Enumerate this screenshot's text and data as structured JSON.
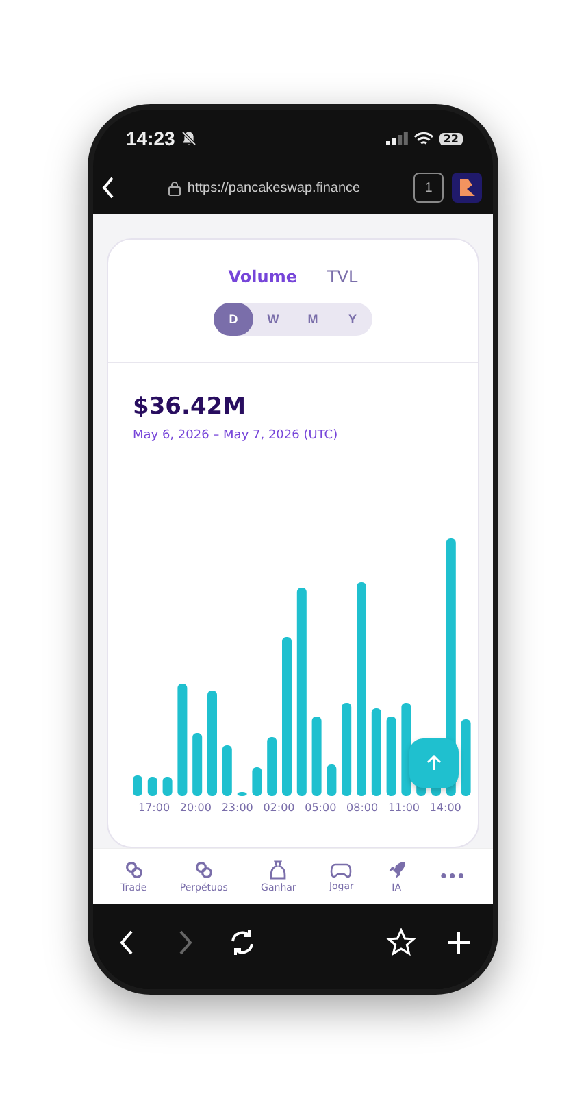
{
  "status_bar": {
    "time": "14:23",
    "battery": "22"
  },
  "browser": {
    "url": "https://pancakeswap.finance",
    "tab_count": "1"
  },
  "metric_tabs": [
    {
      "label": "Volume",
      "selected": true
    },
    {
      "label": "TVL",
      "selected": false
    }
  ],
  "periods": [
    {
      "label": "D",
      "selected": true
    },
    {
      "label": "W",
      "selected": false
    },
    {
      "label": "M",
      "selected": false
    },
    {
      "label": "Y",
      "selected": false
    }
  ],
  "total": "$36.42M",
  "date_range": "May 6, 2026 – May 7, 2026 (UTC)",
  "x_labels": [
    "17:00",
    "20:00",
    "23:00",
    "02:00",
    "05:00",
    "08:00",
    "11:00",
    "14:00"
  ],
  "nav": [
    {
      "label": "Trade",
      "kind": "swap"
    },
    {
      "label": "Perpétuos",
      "kind": "swap"
    },
    {
      "label": "Ganhar",
      "kind": "bag"
    },
    {
      "label": "Jogar",
      "kind": "gamepad"
    },
    {
      "label": "IA",
      "kind": "rocket"
    },
    {
      "label": "•••",
      "kind": "more"
    }
  ],
  "toolbar": [
    {
      "kind": "back",
      "disabled": false
    },
    {
      "kind": "forward",
      "disabled": true
    },
    {
      "kind": "reload",
      "disabled": false
    },
    {
      "kind": "bookmark",
      "disabled": false
    },
    {
      "kind": "new-tab",
      "disabled": false
    }
  ]
}
